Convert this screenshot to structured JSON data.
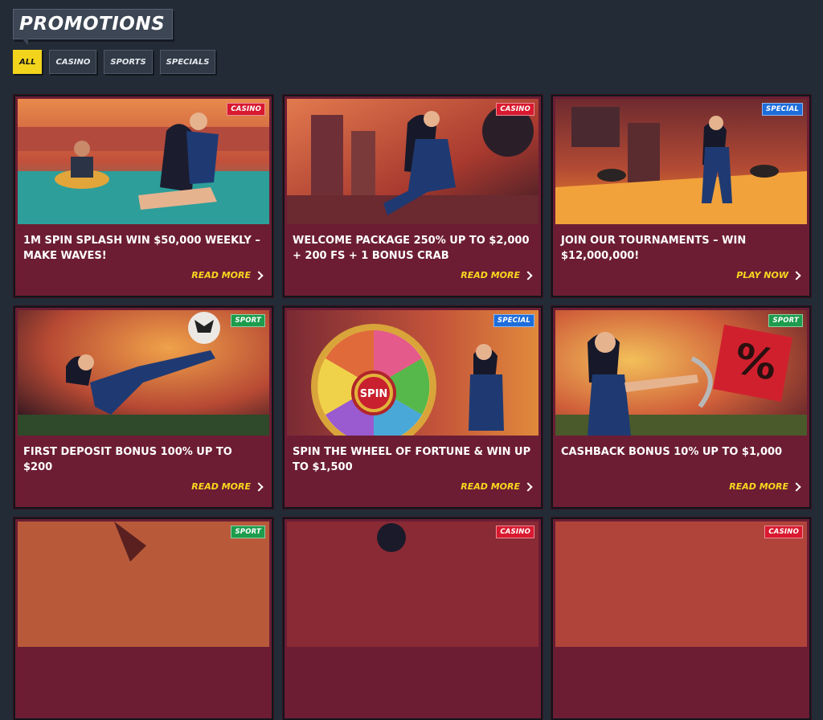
{
  "header": {
    "title": "PROMOTIONS"
  },
  "filters": [
    "ALL",
    "CASINO",
    "SPORTS",
    "SPECIALS"
  ],
  "colors": {
    "accent": "#f2d41c",
    "card_bg": "#6c1d34",
    "page_bg": "#232b36",
    "casino": "#d8192f",
    "special": "#1d6ddb",
    "sport": "#1c9c4c"
  },
  "cards": [
    {
      "badge": "CASINO",
      "title": "1M SPIN SPLASH WIN $50,000 WEEKLY – MAKE WAVES!",
      "cta": "READ MORE"
    },
    {
      "badge": "CASINO",
      "title": "WELCOME PACKAGE 250% UP TO $2,000 + 200 FS + 1 BONUS CRAB",
      "cta": "READ MORE"
    },
    {
      "badge": "SPECIAL",
      "title": "JOIN OUR TOURNAMENTS – WIN $12,000,000!",
      "cta": "PLAY NOW"
    },
    {
      "badge": "SPORT",
      "title": "FIRST DEPOSIT BONUS 100% UP TO $200",
      "cta": "READ MORE"
    },
    {
      "badge": "SPECIAL",
      "title": "SPIN THE WHEEL OF FORTUNE & WIN UP TO $1,500",
      "cta": "READ MORE"
    },
    {
      "badge": "SPORT",
      "title": "CASHBACK BONUS 10% UP TO $1,000",
      "cta": "READ MORE"
    },
    {
      "badge": "SPORT"
    },
    {
      "badge": "CASINO"
    },
    {
      "badge": "CASINO"
    }
  ],
  "wheel": {
    "center_label": "SPIN"
  },
  "cashback_sign": "%"
}
